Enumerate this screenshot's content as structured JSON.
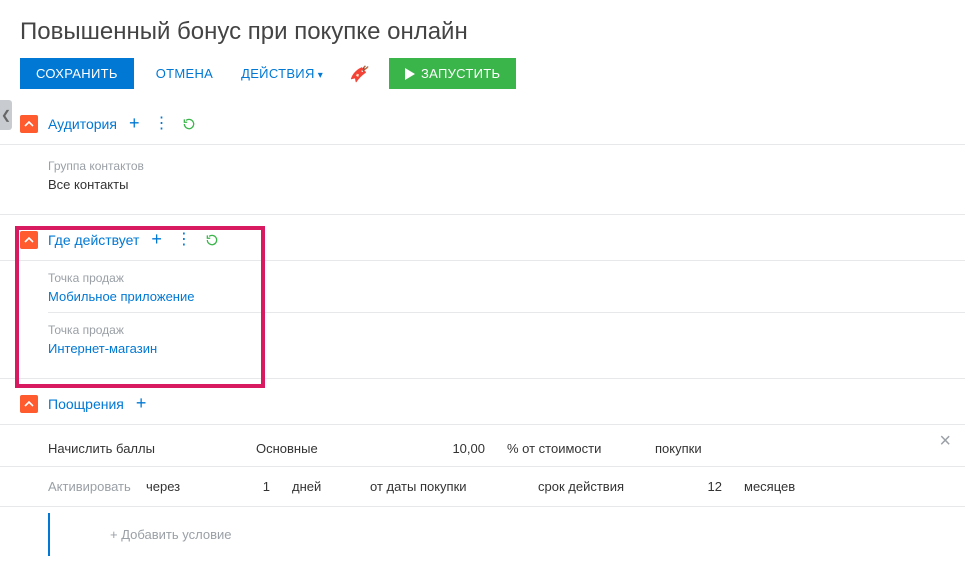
{
  "title": "Повышенный бонус при покупке онлайн",
  "toolbar": {
    "save": "СОХРАНИТЬ",
    "cancel": "ОТМЕНА",
    "actions": "ДЕЙСТВИЯ",
    "run": "ЗАПУСТИТЬ"
  },
  "sections": {
    "audience": {
      "title": "Аудитория",
      "group_label": "Группа контактов",
      "group_value": "Все контакты"
    },
    "where": {
      "title": "Где действует",
      "items": [
        {
          "label": "Точка продаж",
          "value": "Мобильное приложение"
        },
        {
          "label": "Точка продаж",
          "value": "Интернет-магазин"
        }
      ]
    },
    "rewards": {
      "title": "Поощрения",
      "accrue_label": "Начислить баллы",
      "type": "Основные",
      "amount": "10,00",
      "percent_label": "% от стоимости",
      "of_label": "покупки",
      "activate_label": "Активировать",
      "after_label": "через",
      "after_value": "1",
      "after_unit": "дней",
      "from_label": "от даты покупки",
      "validity_label": "срок действия",
      "validity_value": "12",
      "validity_unit": "месяцев",
      "add_condition": "+   Добавить условие"
    }
  }
}
